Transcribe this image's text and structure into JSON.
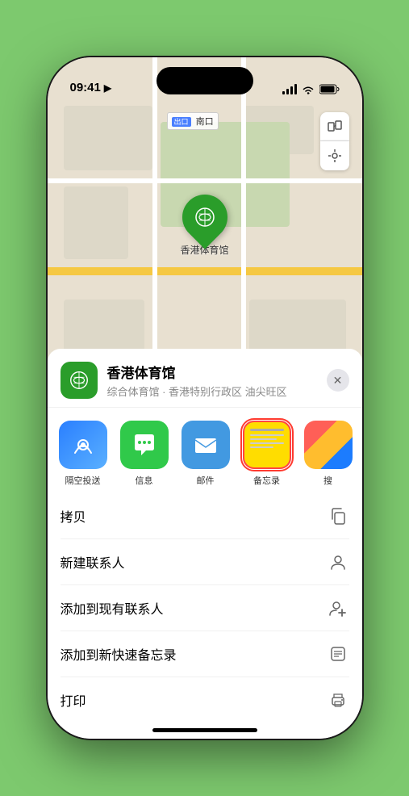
{
  "status": {
    "time": "09:41",
    "location_icon": "▶"
  },
  "map": {
    "label": "南口",
    "venue_name": "香港体育馆",
    "venue_desc": "综合体育馆 · 香港特别行政区 油尖旺区",
    "btn_map": "🗺",
    "btn_location": "➤"
  },
  "share_items": [
    {
      "id": "airdrop",
      "label": "隔空投送"
    },
    {
      "id": "messages",
      "label": "信息"
    },
    {
      "id": "mail",
      "label": "邮件"
    },
    {
      "id": "notes",
      "label": "备忘录"
    },
    {
      "id": "more",
      "label": "搜"
    }
  ],
  "actions": [
    {
      "id": "copy",
      "label": "拷贝",
      "icon": "copy"
    },
    {
      "id": "new-contact",
      "label": "新建联系人",
      "icon": "person"
    },
    {
      "id": "add-existing",
      "label": "添加到现有联系人",
      "icon": "person-add"
    },
    {
      "id": "add-notes",
      "label": "添加到新快速备忘录",
      "icon": "note"
    },
    {
      "id": "print",
      "label": "打印",
      "icon": "printer"
    }
  ]
}
